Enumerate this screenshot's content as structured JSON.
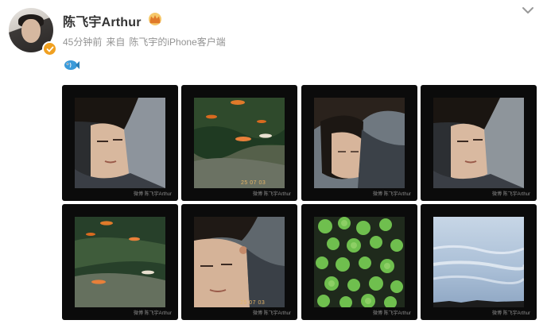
{
  "user": {
    "name": "陈飞宇Arthur",
    "verified_color": "#f0a020"
  },
  "meta": {
    "time": "45分钟前",
    "from_label": "来自",
    "source": "陈飞宇的iPhone客户端"
  },
  "post": {
    "emoji": "fish-emoji-icon"
  },
  "photos": [
    {
      "kind": "portrait",
      "date": "",
      "watermark": ""
    },
    {
      "kind": "koi-pond",
      "date": "25 07 03",
      "watermark": ""
    },
    {
      "kind": "portrait-down",
      "date": "",
      "watermark": ""
    },
    {
      "kind": "portrait",
      "date": "",
      "watermark": ""
    },
    {
      "kind": "koi-pond",
      "date": "",
      "watermark": ""
    },
    {
      "kind": "portrait-closeup",
      "date": "25 07 03",
      "watermark": ""
    },
    {
      "kind": "lily-pads",
      "date": "",
      "watermark": ""
    },
    {
      "kind": "sky",
      "date": "",
      "watermark": ""
    }
  ],
  "colors": {
    "frame": "#0b0b0b",
    "meta_text": "#939393",
    "name_text": "#333333"
  }
}
